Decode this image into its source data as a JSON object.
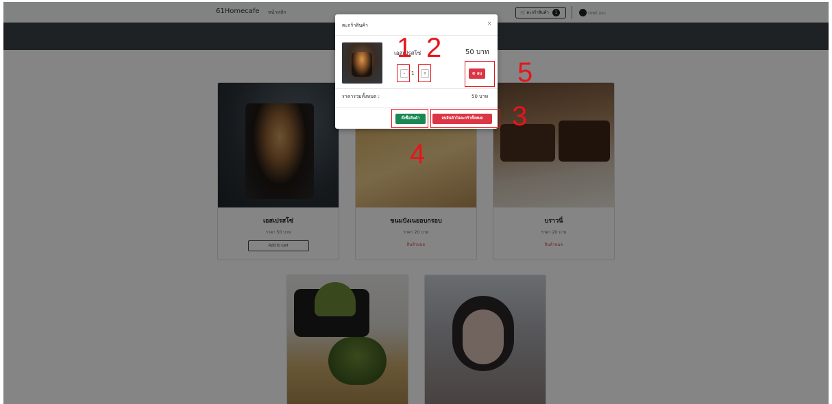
{
  "navbar": {
    "brand": "61Homecafe",
    "home": "หน้าหลัก",
    "cart_label": "ตะกร้าสินค้า",
    "cart_count": "1",
    "user_name": "เชพย์ ฮอง"
  },
  "products": [
    {
      "name": "เอสเปรสโซ่",
      "price": "ราคา 50 บาท",
      "action": "Add to cart",
      "image_icon": "espresso-image"
    },
    {
      "name": "ขนมปังเนยอบกรอบ",
      "price": "ราคา 20 บาท",
      "status": "สินค้าหมด",
      "image_icon": "butter-toast-image"
    },
    {
      "name": "บราวนี่",
      "price": "ราคา 20 บาท",
      "status": "สินค้าหมด",
      "image_icon": "brownie-image"
    },
    {
      "image_icon": "matcha-image"
    },
    {
      "image_icon": "portrait-image"
    }
  ],
  "modal": {
    "title": "ตะกร้าสินค้า",
    "close": "×",
    "item": {
      "name": "เอสเปรสโซ่",
      "price": "50 บาท",
      "qty": "1",
      "minus": "-",
      "plus": "+",
      "remove": "ลบ"
    },
    "total_label": "ราคารวมทั้งหมด :",
    "total_value": "50 บาท",
    "order_button": "สั่งซื้อสินค้า",
    "clear_button": "ลบสินค้าในตะกร้าทั้งหมด"
  },
  "annotations": [
    "1",
    "2",
    "3",
    "4",
    "5"
  ],
  "colors": {
    "annotation": "#e8141b",
    "header_band": "#3b4147",
    "danger": "#dc3545",
    "success": "#198754"
  }
}
